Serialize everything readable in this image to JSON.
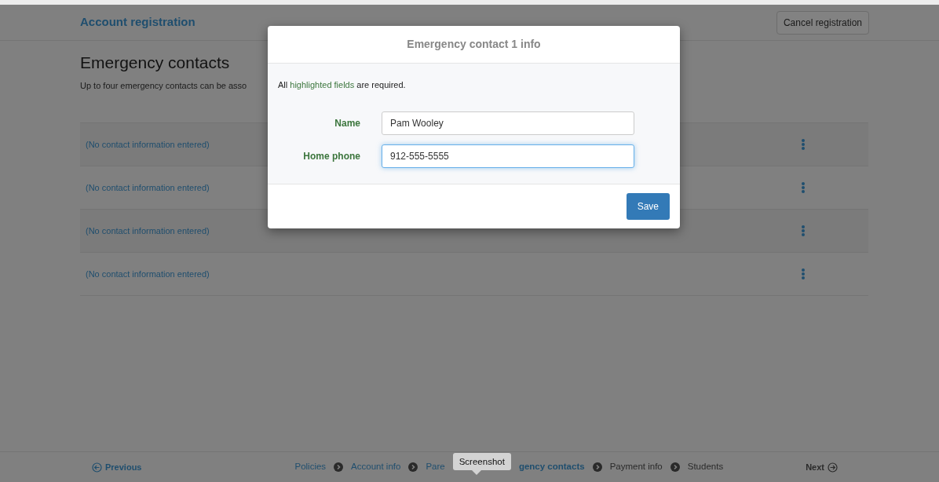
{
  "header": {
    "title": "Account registration",
    "cancel_button": "Cancel registration"
  },
  "page": {
    "heading": "Emergency contacts",
    "description": "Up to four emergency contacts can be asso"
  },
  "contacts": [
    {
      "text": "(No contact information entered)"
    },
    {
      "text": "(No contact information entered)"
    },
    {
      "text": "(No contact information entered)"
    },
    {
      "text": "(No contact information entered)"
    }
  ],
  "modal": {
    "title": "Emergency contact 1 info",
    "note_parts": [
      "All ",
      "highlighted fields",
      " are required."
    ],
    "fields": [
      {
        "label": "Name",
        "value": "Pam Wooley",
        "focused": false
      },
      {
        "label": "Home phone",
        "value": "912-555-5555",
        "focused": true
      }
    ],
    "save_button": "Save"
  },
  "footer": {
    "previous": "Previous",
    "next": "Next",
    "steps": [
      {
        "label": "Policies",
        "completed": true,
        "selected": false
      },
      {
        "label": "Account info",
        "completed": true,
        "selected": false
      },
      {
        "label": "Pare",
        "completed": true,
        "selected": false
      },
      {
        "label": "gency contacts",
        "completed": false,
        "selected": true
      },
      {
        "label": "Payment info",
        "completed": false,
        "selected": false
      },
      {
        "label": "Students",
        "completed": false,
        "selected": false
      }
    ],
    "tooltip": "Screenshot"
  }
}
